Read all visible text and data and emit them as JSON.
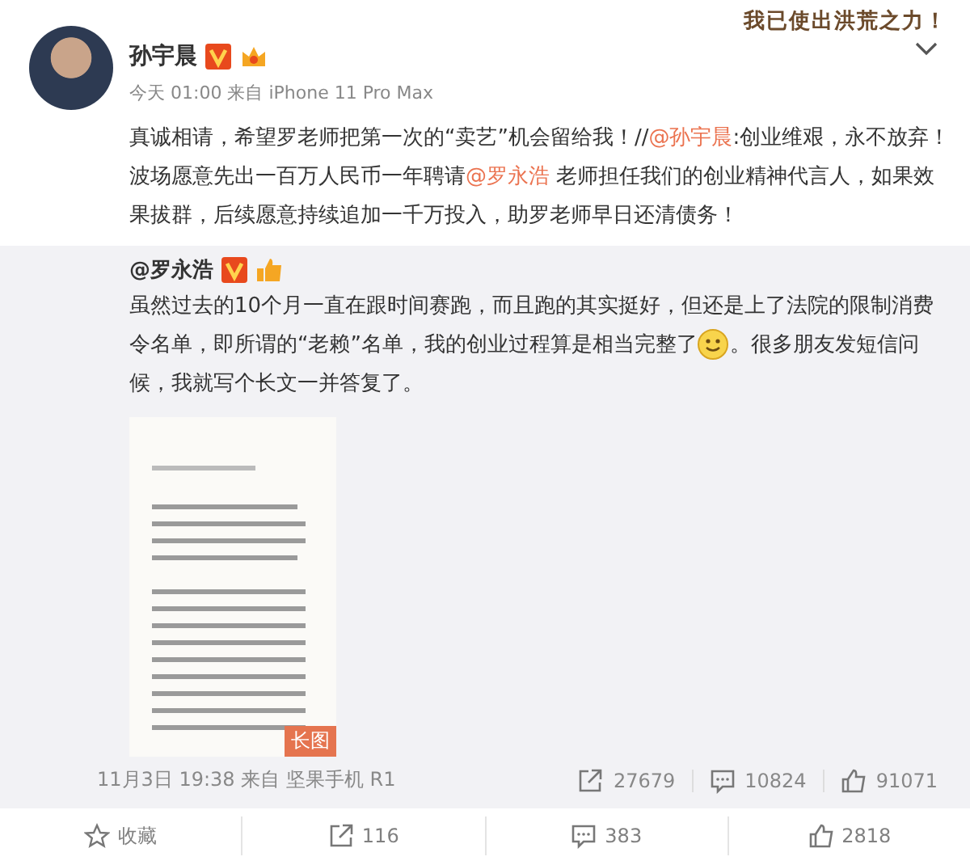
{
  "banner": {
    "text": "我已使出洪荒之力！"
  },
  "post": {
    "author": "孙宇晨",
    "verified": true,
    "time": "今天 01:00",
    "source_prefix": "来自",
    "source": "iPhone 11 Pro Max",
    "content": [
      {
        "kind": "text",
        "text": "真诚相请，希望罗老师把第一次的“卖艺”机会留给我！//"
      },
      {
        "kind": "link",
        "text": "@孙宇晨"
      },
      {
        "kind": "text",
        "text": ":创业维艰，永不放弃！波场愿意先出一百万人民币一年聘请"
      },
      {
        "kind": "link",
        "text": "@罗永浩"
      },
      {
        "kind": "text",
        "text": " 老师担任我们的创业精神代言人，如果效果拔群，后续愿意持续追加一千万投入，助罗老师早日还清债务！"
      }
    ]
  },
  "repost": {
    "author": "@罗永浩",
    "verified": true,
    "content": [
      {
        "kind": "text",
        "text": "虽然过去的10个月一直在跟时间赛跑，而且跑的其实挺好，但还是上了法院的限制消费令名单，即所谓的“老赖”名单，我的创业过程算是相当完整了"
      },
      {
        "kind": "emoji"
      },
      {
        "kind": "text",
        "text": "。很多朋友发短信问候，我就写个长文一并答复了。"
      }
    ],
    "image": {
      "kind": "picture",
      "badge": "长图"
    },
    "time": "11月3日 19:38",
    "source_prefix": "来自",
    "source": "坚果手机 R1",
    "stats": [
      {
        "kind": "share",
        "count": "27679"
      },
      {
        "kind": "comment",
        "count": "10824"
      },
      {
        "kind": "like",
        "count": "91071"
      }
    ]
  },
  "actions": [
    {
      "kind": "favorite",
      "label": "收藏"
    },
    {
      "kind": "share",
      "label": "116"
    },
    {
      "kind": "comment",
      "label": "383"
    },
    {
      "kind": "like",
      "label": "2818"
    }
  ]
}
